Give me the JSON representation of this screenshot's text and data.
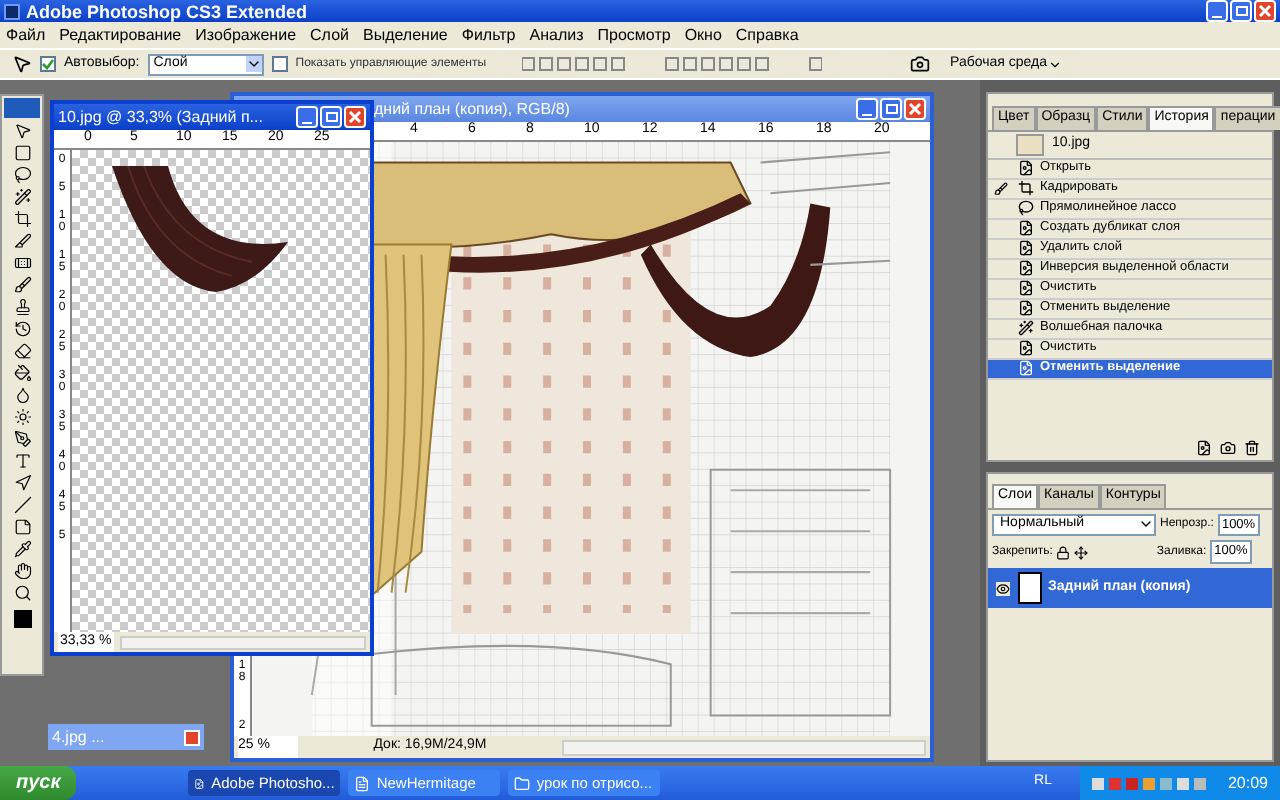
{
  "window": {
    "title": "Adobe Photoshop CS3 Extended"
  },
  "menu": [
    "Файл",
    "Редактирование",
    "Изображение",
    "Слой",
    "Выделение",
    "Фильтр",
    "Анализ",
    "Просмотр",
    "Окно",
    "Справка"
  ],
  "options_bar": {
    "auto_select": {
      "label": "Автовыбор:",
      "checked": true
    },
    "auto_select_target": "Слой",
    "show_controls": {
      "label": "Показать управляющие элементы",
      "checked": false
    },
    "workspace": "Рабочая среда"
  },
  "main_document": {
    "title": "дний план (копия), RGB/8)",
    "ruler_marks": [
      "4",
      "6",
      "8",
      "10",
      "12",
      "14",
      "16",
      "18",
      "20"
    ],
    "side_marks": [
      "1\n8",
      "2"
    ],
    "zoom": "25 %",
    "doc_size": "Док: 16,9M/24,9M"
  },
  "small_document": {
    "title": "10.jpg @ 33,3% (Задний п...",
    "ruler_marks": [
      "0",
      "5",
      "10",
      "15",
      "20",
      "25"
    ],
    "side_marks": [
      "0",
      "5",
      "1\n0",
      "1\n5",
      "2\n0",
      "2\n5",
      "3\n0",
      "3\n5",
      "4\n0",
      "4\n5",
      "5"
    ],
    "zoom": "33,33 %"
  },
  "minimized_document": {
    "title": "4.jpg ..."
  },
  "history_panel": {
    "tabs": [
      {
        "label": "Цвет",
        "selected": false
      },
      {
        "label": "Образц",
        "selected": false
      },
      {
        "label": "Стили",
        "selected": false
      },
      {
        "label": "История",
        "selected": true
      },
      {
        "label": "перации",
        "selected": false
      }
    ],
    "snapshot": "10.jpg",
    "items": [
      {
        "label": "Открыть",
        "kind": "doc",
        "selected": false,
        "source": false
      },
      {
        "label": "Кадрировать",
        "kind": "crop",
        "selected": false,
        "source": true
      },
      {
        "label": "Прямолинейное лассо",
        "kind": "lasso",
        "selected": false,
        "source": false
      },
      {
        "label": "Создать дубликат слоя",
        "kind": "doc",
        "selected": false,
        "source": false
      },
      {
        "label": "Удалить слой",
        "kind": "doc",
        "selected": false,
        "source": false
      },
      {
        "label": "Инверсия выделенной области",
        "kind": "doc",
        "selected": false,
        "source": false
      },
      {
        "label": "Очистить",
        "kind": "doc",
        "selected": false,
        "source": false
      },
      {
        "label": "Отменить выделение",
        "kind": "doc",
        "selected": false,
        "source": false
      },
      {
        "label": "Волшебная палочка",
        "kind": "wand",
        "selected": false,
        "source": false
      },
      {
        "label": "Очистить",
        "kind": "doc",
        "selected": false,
        "source": false
      },
      {
        "label": "Отменить выделение",
        "kind": "doc",
        "selected": true,
        "source": false
      }
    ]
  },
  "layers_panel": {
    "tabs": [
      {
        "label": "Слои",
        "selected": true
      },
      {
        "label": "Каналы",
        "selected": false
      },
      {
        "label": "Контуры",
        "selected": false
      }
    ],
    "blend_mode": "Нормальный",
    "opacity_label": "Непрозр.:",
    "opacity": "100%",
    "lock_label": "Закрепить:",
    "fill_label": "Заливка:",
    "fill": "100%",
    "layers": [
      {
        "name": "Задний план (копия)",
        "selected": true,
        "visible": true
      }
    ]
  },
  "taskbar": {
    "start": "пуск",
    "tasks": [
      {
        "label": "Adobe Photosho...",
        "kind": "ps",
        "selected": true
      },
      {
        "label": "NewHermitage",
        "kind": "doc",
        "selected": false
      },
      {
        "label": "урок по отрисо...",
        "kind": "folder",
        "selected": false
      }
    ],
    "language": "RL",
    "clock": "20:09"
  }
}
